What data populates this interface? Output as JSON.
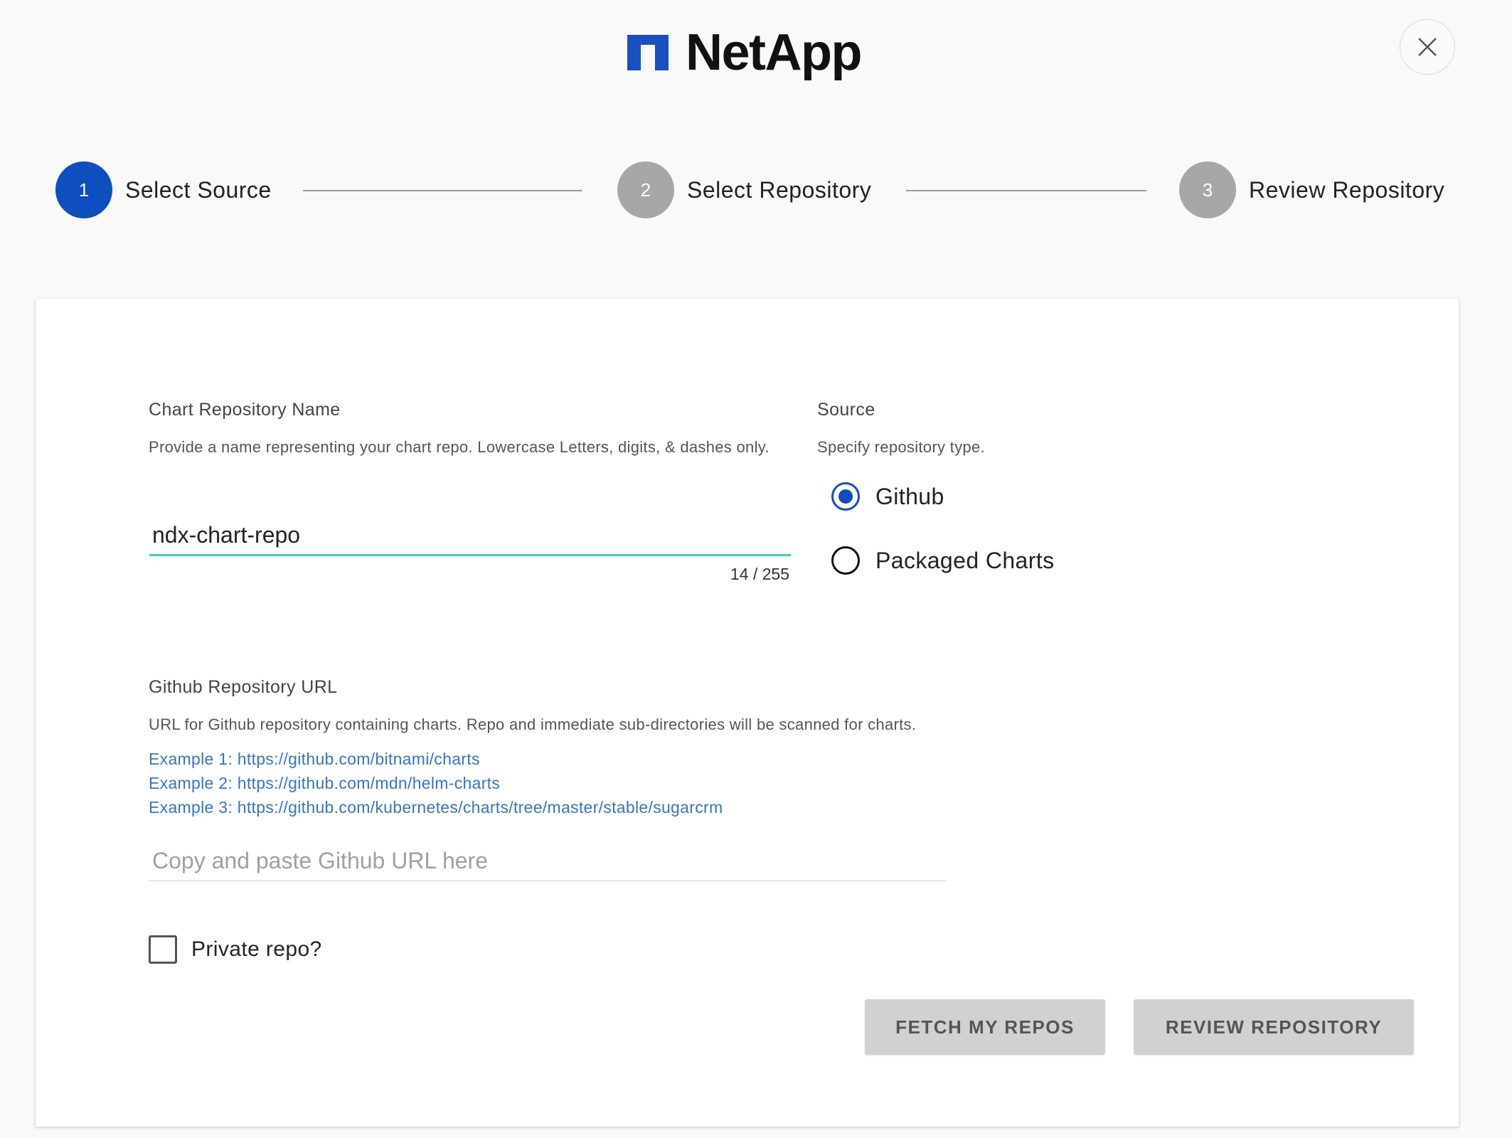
{
  "header": {
    "logo_text": "NetApp",
    "close_icon": "close-icon"
  },
  "stepper": {
    "steps": [
      {
        "number": "1",
        "label": "Select Source",
        "state": "active"
      },
      {
        "number": "2",
        "label": "Select Repository",
        "state": "inactive"
      },
      {
        "number": "3",
        "label": "Review Repository",
        "state": "inactive"
      }
    ]
  },
  "form": {
    "chart_name": {
      "title": "Chart Repository Name",
      "help": "Provide a name representing your chart repo. Lowercase Letters, digits, & dashes only.",
      "value": "ndx-chart-repo",
      "counter": "14 / 255"
    },
    "source": {
      "title": "Source",
      "help": "Specify repository type.",
      "options": [
        {
          "label": "Github",
          "checked": true
        },
        {
          "label": "Packaged Charts",
          "checked": false
        }
      ]
    },
    "github_url": {
      "title": "Github Repository URL",
      "help": "URL for Github repository containing charts. Repo and immediate sub-directories will be scanned for charts.",
      "examples": [
        "Example 1: https://github.com/bitnami/charts",
        "Example 2: https://github.com/mdn/helm-charts",
        "Example 3: https://github.com/kubernetes/charts/tree/master/stable/sugarcrm"
      ],
      "placeholder": "Copy and paste Github URL here",
      "value": ""
    },
    "private_repo": {
      "label": "Private repo?",
      "checked": false
    }
  },
  "actions": {
    "fetch_label": "FETCH MY REPOS",
    "review_label": "REVIEW REPOSITORY"
  },
  "colors": {
    "primary": "#0f4ebf",
    "inactive_step": "#a7a7a7",
    "input_focus": "#3fd0b7",
    "link": "#3a73c4",
    "button_bg": "#d1d1d1"
  }
}
